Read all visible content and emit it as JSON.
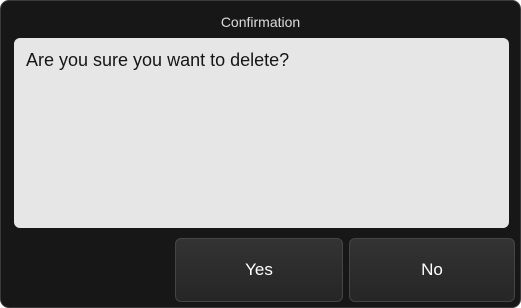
{
  "dialog": {
    "title": "Confirmation",
    "message": "Are you sure you want to delete?",
    "buttons": {
      "yes_label": "Yes",
      "no_label": "No"
    }
  }
}
